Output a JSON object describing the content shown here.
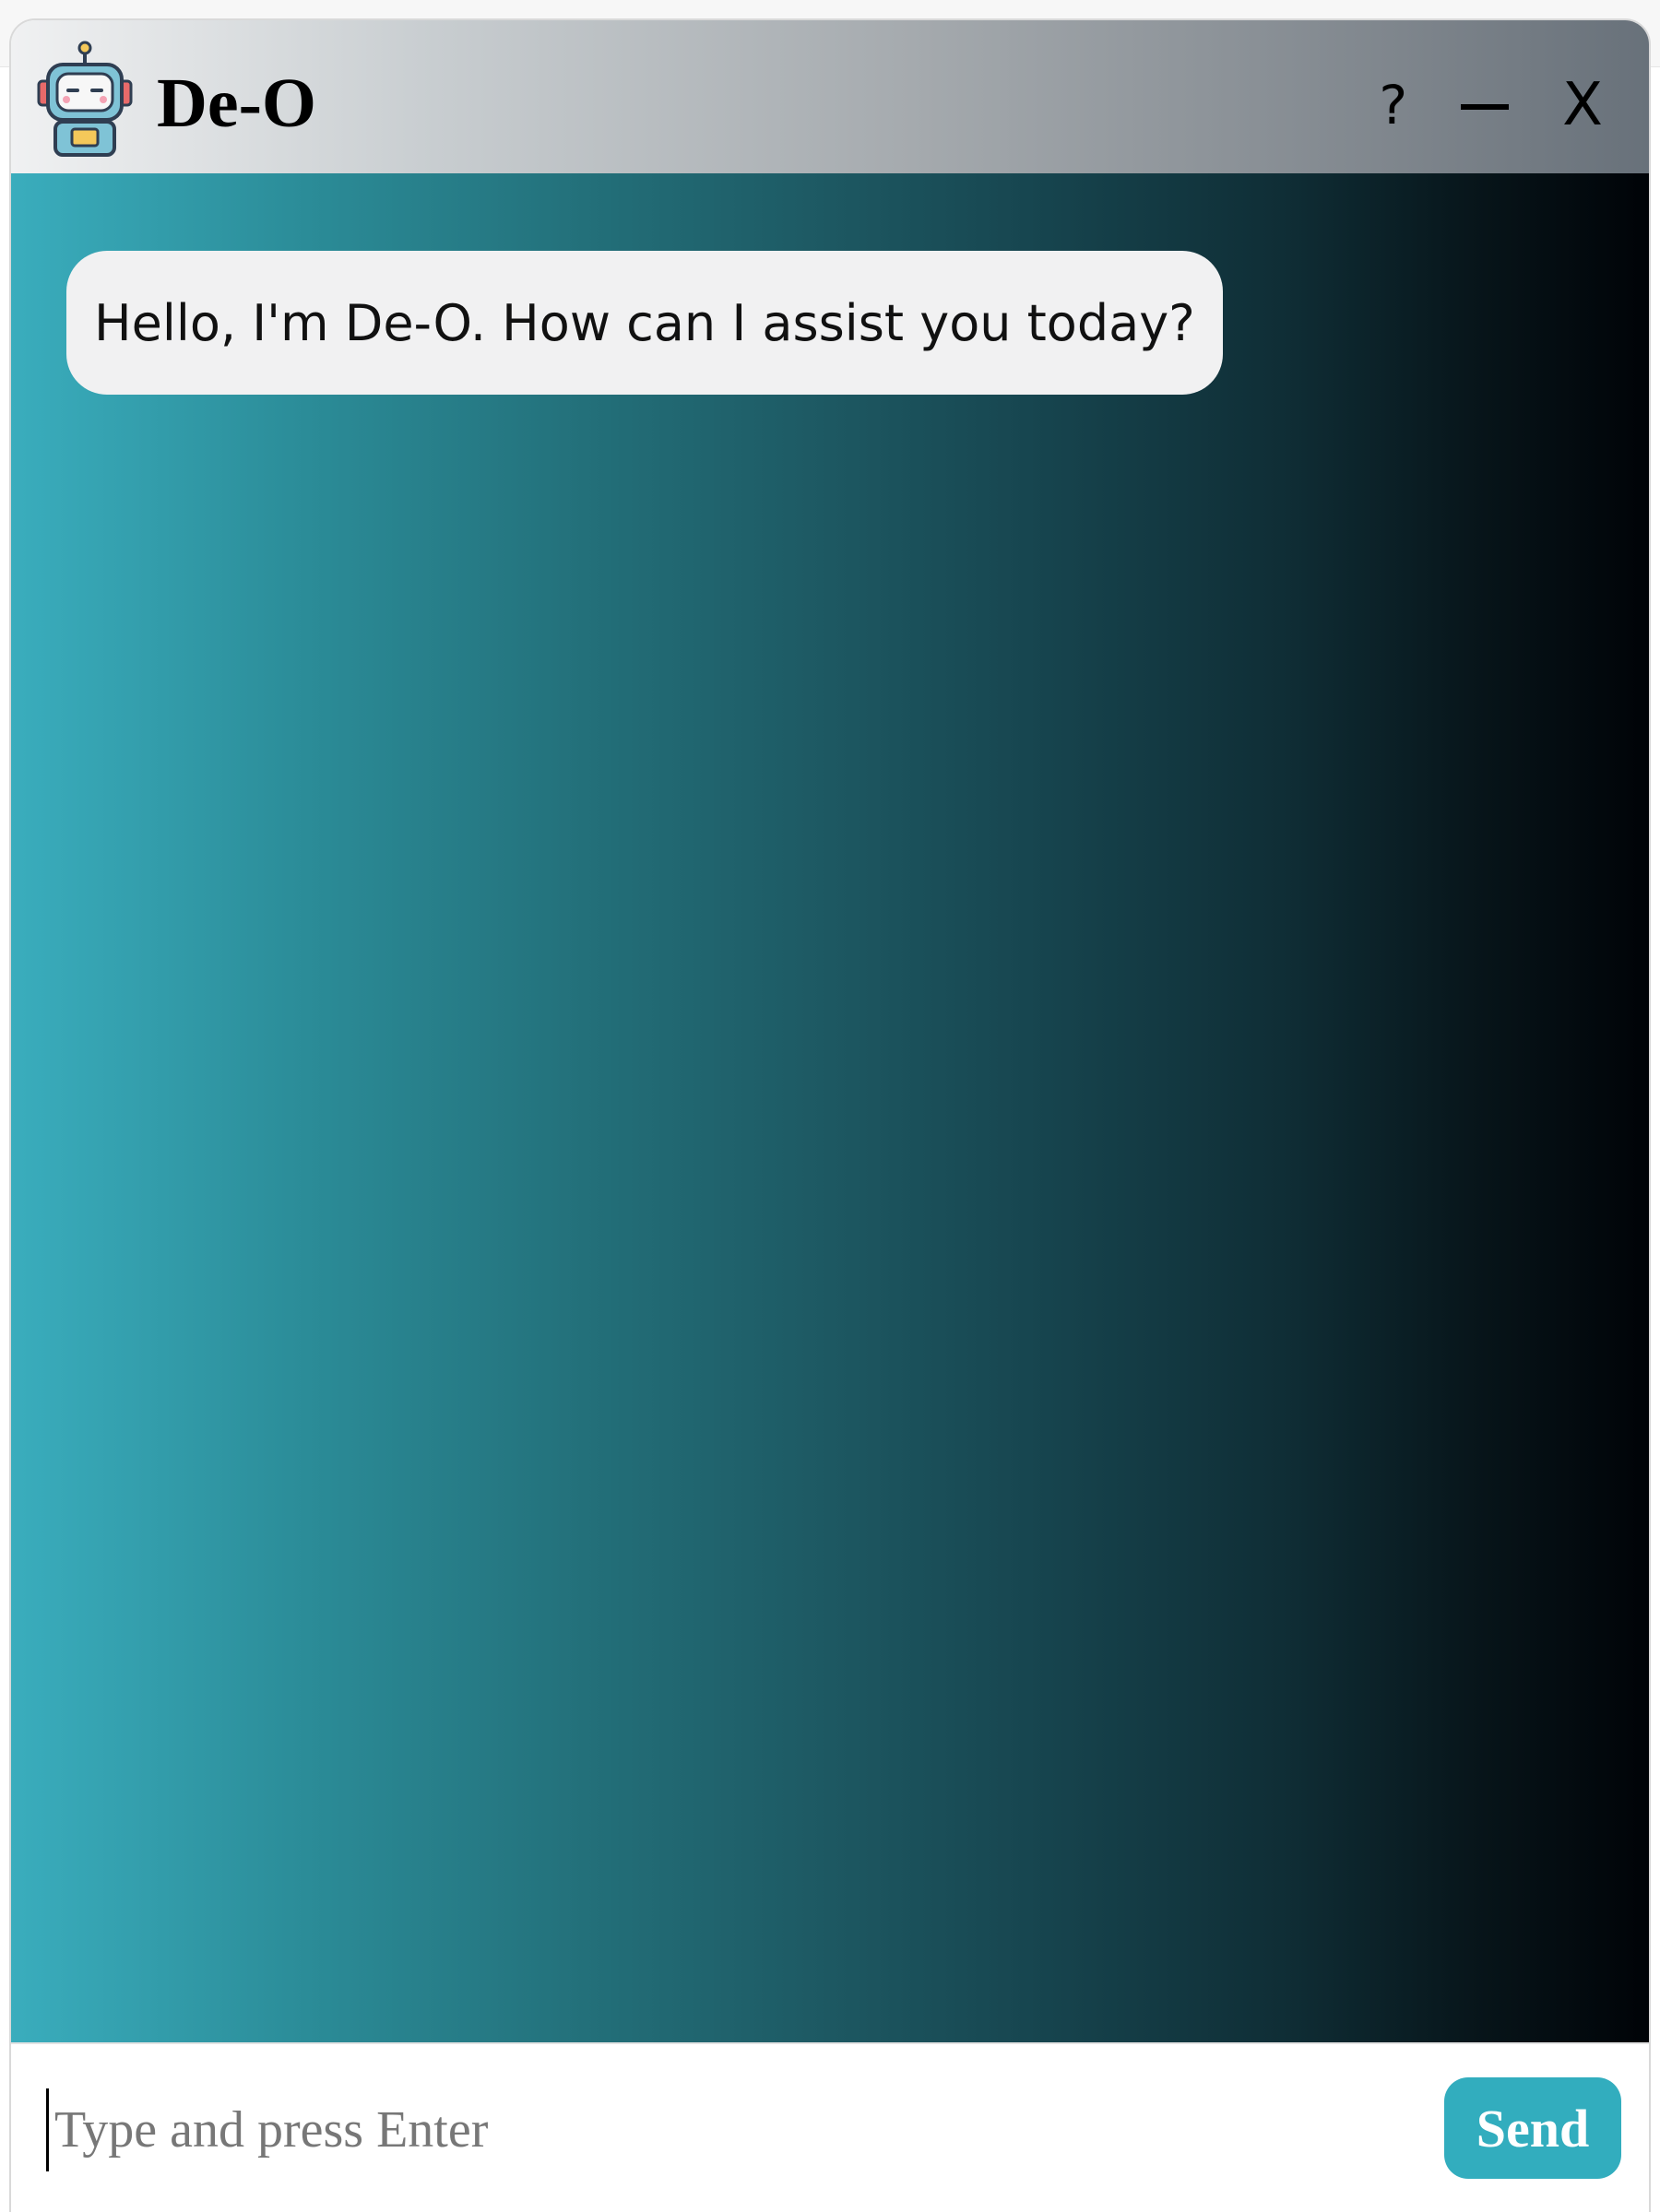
{
  "header": {
    "title": "De-O",
    "logo_icon": "robot-icon",
    "controls": {
      "help_label": "?",
      "minimize_icon": "minimize-icon",
      "close_label": "X"
    }
  },
  "chat": {
    "messages": [
      {
        "sender": "bot",
        "text": "Hello, I'm De-O. How can I assist you today?"
      }
    ],
    "gradient_colors": [
      "#3aadbd",
      "#1d5862",
      "#000307"
    ]
  },
  "composer": {
    "placeholder": "Type and press Enter",
    "value": "",
    "send_label": "Send",
    "send_color": "#32adbe"
  }
}
